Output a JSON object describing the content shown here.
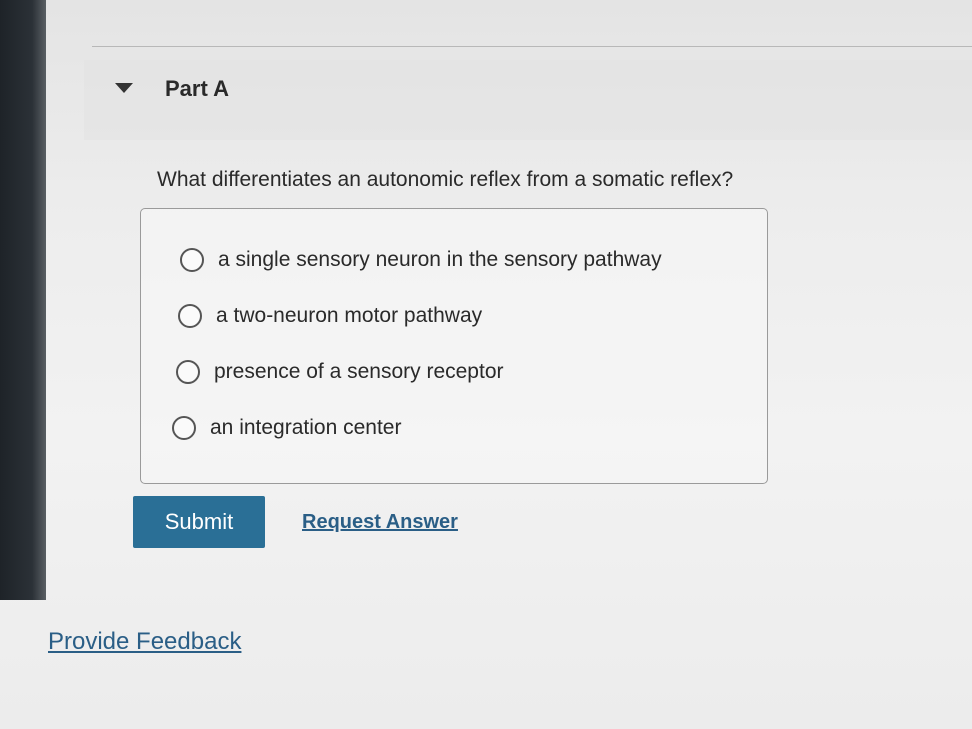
{
  "part": {
    "title": "Part A"
  },
  "question": {
    "text": "What differentiates an autonomic reflex from a somatic reflex?"
  },
  "options": [
    {
      "label": "a single sensory neuron in the sensory pathway"
    },
    {
      "label": "a two-neuron motor pathway"
    },
    {
      "label": "presence of a sensory receptor"
    },
    {
      "label": "an integration center"
    }
  ],
  "actions": {
    "submit_label": "Submit",
    "request_answer_label": "Request Answer"
  },
  "footer": {
    "feedback_label": "Provide Feedback"
  },
  "colors": {
    "submit_background": "#2a6f96",
    "link_color": "#2a5e86"
  },
  "icons": {
    "collapse": "caret-down-icon",
    "choice": "radio-button-icon"
  }
}
